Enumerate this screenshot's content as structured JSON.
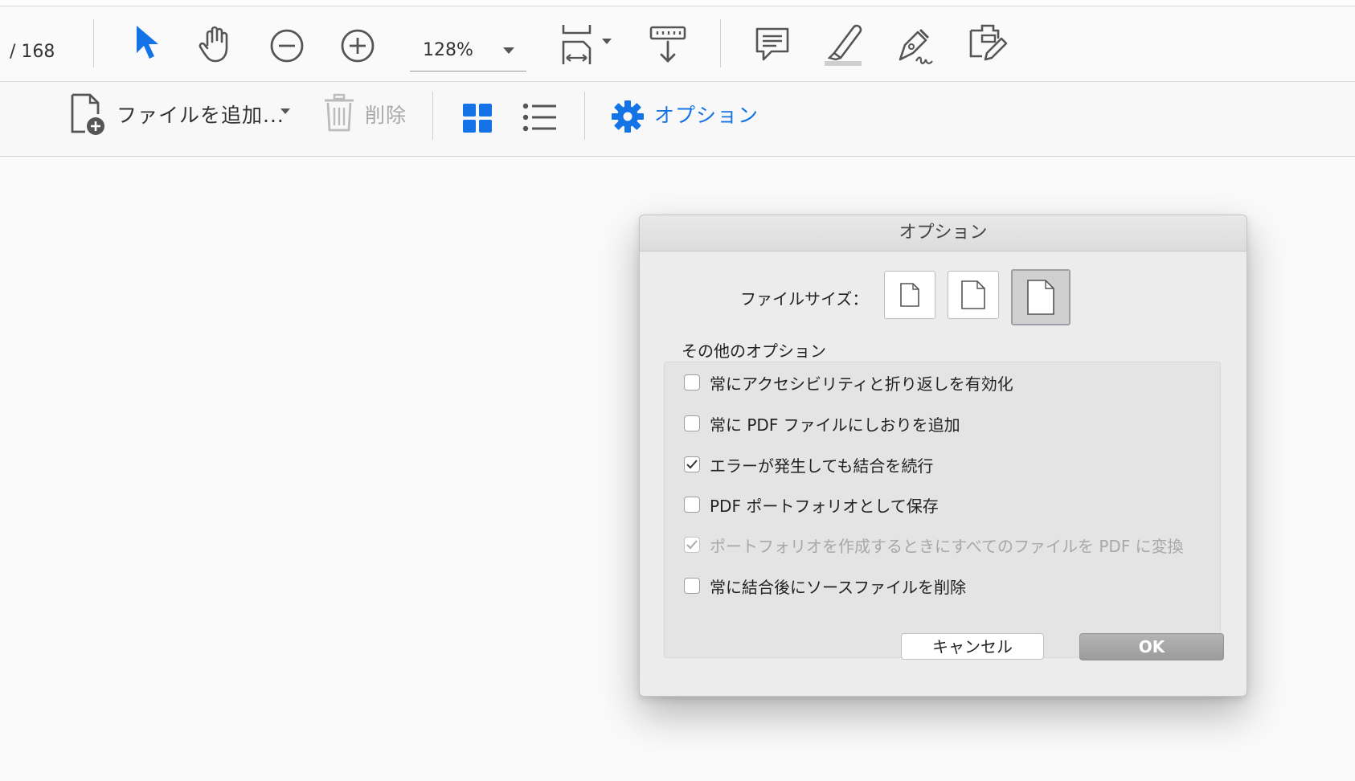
{
  "toolbar": {
    "page_count": "/ 168",
    "zoom": "128%",
    "icons": [
      "select-arrow-icon",
      "hand-icon",
      "zoom-out-icon",
      "zoom-in-icon",
      "zoom-dropdown-icon",
      "fit-page-icon",
      "scroll-mode-icon",
      "comment-icon",
      "highlight-icon",
      "sign-icon",
      "fill-sign-icon"
    ]
  },
  "combine_bar": {
    "add_files_label": "ファイルを追加...",
    "delete_label": "削除",
    "options_label": "オプション",
    "accent_color": "#1473e6"
  },
  "dialog": {
    "title": "オプション",
    "file_size_label": "ファイルサイズ：",
    "file_size_options": [
      "small-file-size",
      "medium-file-size",
      "large-file-size"
    ],
    "file_size_selected": 2,
    "other_options_label": "その他のオプション",
    "options": [
      {
        "label": "常にアクセシビリティと折り返しを有効化",
        "checked": false,
        "disabled": false
      },
      {
        "label": "常に PDF ファイルにしおりを追加",
        "checked": false,
        "disabled": false
      },
      {
        "label": "エラーが発生しても結合を続行",
        "checked": true,
        "disabled": false
      },
      {
        "label": "PDF ポートフォリオとして保存",
        "checked": false,
        "disabled": false
      },
      {
        "label": "ポートフォリオを作成するときにすべてのファイルを PDF に変換",
        "checked": true,
        "disabled": true
      },
      {
        "label": "常に結合後にソースファイルを削除",
        "checked": false,
        "disabled": false
      }
    ],
    "cancel_label": "キャンセル",
    "ok_label": "OK"
  }
}
